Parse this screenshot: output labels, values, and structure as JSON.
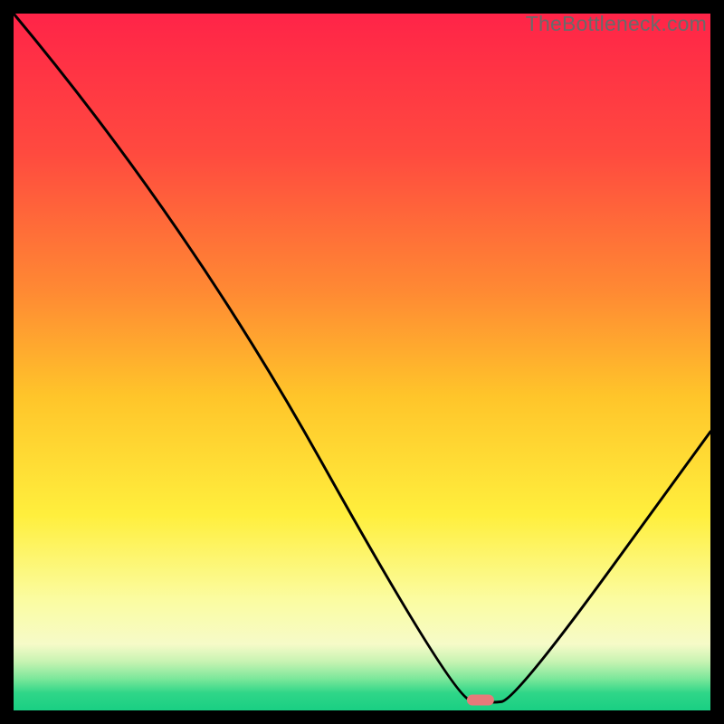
{
  "watermark": "TheBottleneck.com",
  "chart_data": {
    "type": "line",
    "title": "",
    "xlabel": "",
    "ylabel": "",
    "xlim": [
      0,
      100
    ],
    "ylim": [
      0,
      100
    ],
    "series": [
      {
        "name": "bottleneck-curve",
        "x": [
          0,
          25,
          63,
          68,
          72,
          100
        ],
        "values": [
          100,
          70,
          2,
          1,
          1.5,
          40
        ]
      }
    ],
    "marker": {
      "x": 67,
      "y": 1.5,
      "color": "#e77a7a"
    },
    "gradient_stops": [
      {
        "offset": 0.0,
        "color": "#ff2448"
      },
      {
        "offset": 0.2,
        "color": "#ff4a3f"
      },
      {
        "offset": 0.4,
        "color": "#ff8a33"
      },
      {
        "offset": 0.55,
        "color": "#ffc52a"
      },
      {
        "offset": 0.72,
        "color": "#ffef3d"
      },
      {
        "offset": 0.84,
        "color": "#fbfca0"
      },
      {
        "offset": 0.905,
        "color": "#f6fbc8"
      },
      {
        "offset": 0.93,
        "color": "#c7f3b2"
      },
      {
        "offset": 0.955,
        "color": "#7ae79a"
      },
      {
        "offset": 0.975,
        "color": "#2fd688"
      },
      {
        "offset": 1.0,
        "color": "#19cf83"
      }
    ]
  }
}
